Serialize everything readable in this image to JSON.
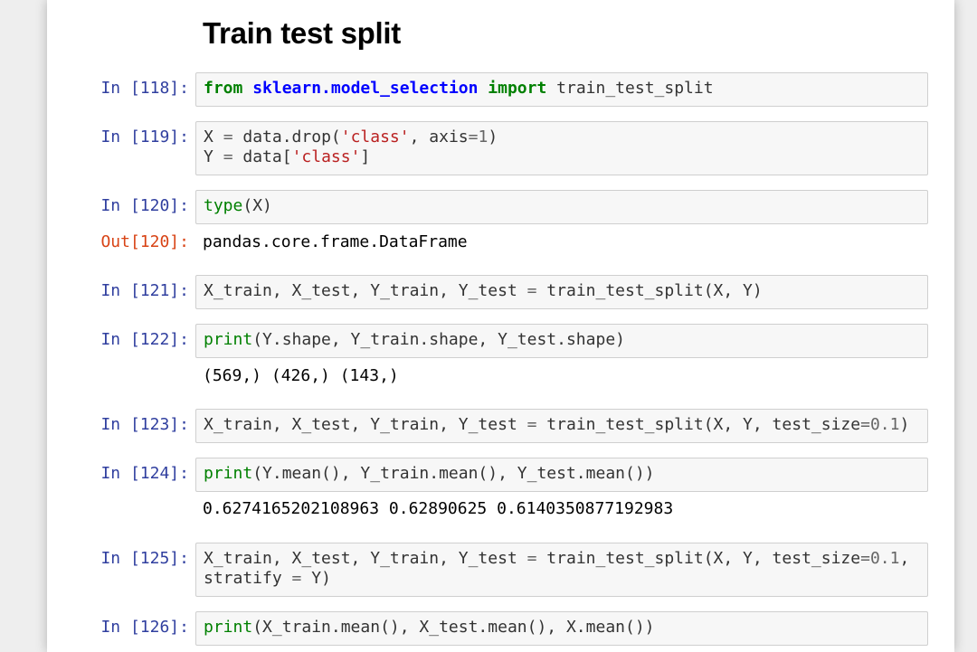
{
  "heading": "Train test split",
  "cells": {
    "c118": {
      "prompt": "In [118]:",
      "t1": "from",
      "t2": " ",
      "t3": "sklearn.model_selection",
      "t4": " ",
      "t5": "import",
      "t6": " train_test_split"
    },
    "c119": {
      "prompt": "In [119]:",
      "l1a": "X ",
      "l1b": "=",
      "l1c": " data.drop(",
      "l1d": "'class'",
      "l1e": ", axis",
      "l1f": "=",
      "l1g": "1",
      "l1h": ")",
      "l2a": "Y ",
      "l2b": "=",
      "l2c": " data[",
      "l2d": "'class'",
      "l2e": "]"
    },
    "c120": {
      "prompt": "In [120]:",
      "t1": "type",
      "t2": "(X)",
      "out_prompt": "Out[120]:",
      "output": "pandas.core.frame.DataFrame"
    },
    "c121": {
      "prompt": "In [121]:",
      "t1": "X_train, X_test, Y_train, Y_test ",
      "t2": "=",
      "t3": " train_test_split(X, Y)"
    },
    "c122": {
      "prompt": "In [122]:",
      "t1": "print",
      "t2": "(Y.shape, Y_train.shape, Y_test.shape)",
      "output": "(569,) (426,) (143,)"
    },
    "c123": {
      "prompt": "In [123]:",
      "t1": "X_train, X_test, Y_train, Y_test ",
      "t2": "=",
      "t3": " train_test_split(X, Y, test_size",
      "t4": "=",
      "t5": "0.1",
      "t6": ")"
    },
    "c124": {
      "prompt": "In [124]:",
      "t1": "print",
      "t2": "(Y.mean(), Y_train.mean(), Y_test.mean())",
      "output": "0.6274165202108963 0.62890625 0.6140350877192983"
    },
    "c125": {
      "prompt": "In [125]:",
      "l1a": "X_train, X_test, Y_train, Y_test ",
      "l1b": "=",
      "l1c": " train_test_split(X, Y, test_size",
      "l1d": "=",
      "l1e": "0.1",
      "l1f": ",",
      "l2a": "stratify ",
      "l2b": "=",
      "l2c": " Y)"
    },
    "c126": {
      "prompt": "In [126]:",
      "t1": "print",
      "t2": "(X_train.mean(), X_test.mean(), X.mean())"
    }
  }
}
